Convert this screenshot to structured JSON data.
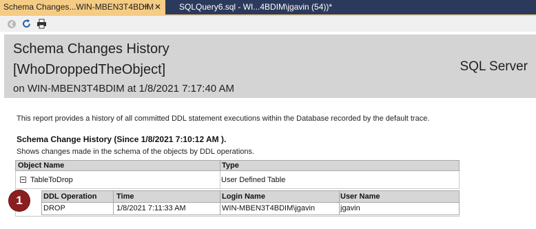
{
  "tabs": [
    {
      "label": "Schema Changes...WIN-MBEN3T4BDIM",
      "active": true
    },
    {
      "label": "SQLQuery6.sql - WI...4BDIM\\jgavin (54))*",
      "active": false
    }
  ],
  "toolbar": {
    "icons": [
      "back-icon",
      "refresh-icon",
      "print-icon"
    ]
  },
  "report": {
    "title_line1": "Schema Changes History",
    "title_line2": "[WhoDroppedTheObject]",
    "subtitle": "on WIN-MBEN3T4BDIM at 1/8/2021 7:17:40 AM",
    "brand": "SQL Server"
  },
  "description": "This report provides a history of all committed DDL statement executions within the Database recorded by the default trace.",
  "section": {
    "title": "Schema Change History (Since 1/8/2021 7:10:12 AM ).",
    "note": "Shows changes made in the schema of the objects by DDL operations."
  },
  "grid": {
    "columns": [
      "Object Name",
      "Type"
    ],
    "rows": [
      {
        "object_name": "TableToDrop",
        "type": "User Defined Table",
        "detail_columns": [
          "DDL Operation",
          "Time",
          "Login Name",
          "User Name"
        ],
        "details": [
          [
            "DROP",
            "1/8/2021 7:11:33 AM",
            "WIN-MBEN3T4BDIM\\jgavin",
            "jgavin"
          ]
        ]
      }
    ]
  },
  "badge": "1",
  "colors": {
    "tab_strip": "#2b3a5c",
    "active_tab": "#f5cc84",
    "header_band": "#d4d4d4",
    "badge": "#8b1f1f"
  }
}
